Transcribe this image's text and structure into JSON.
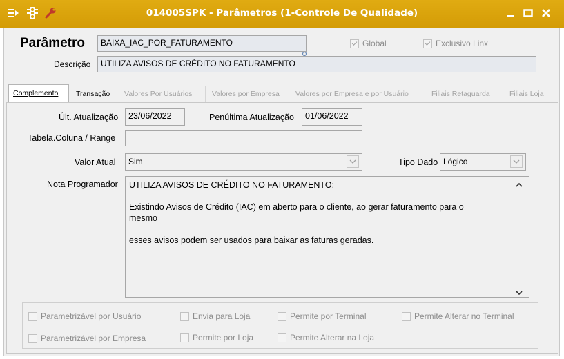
{
  "window": {
    "title": "014005SPK - Parâmetros (1-Controle De Qualidade)"
  },
  "header": {
    "parametro_label": "Parâmetro",
    "parametro_value": "BAIXA_IAC_POR_FATURAMENTO",
    "global_label": "Global",
    "global_checked": true,
    "exclusivo_label": "Exclusivo Linx",
    "exclusivo_checked": true,
    "descricao_label": "Descrição",
    "descricao_value": "UTILIZA AVISOS DE CRÉDITO NO FATURAMENTO"
  },
  "tabs": [
    {
      "label": "Complemento",
      "state": "active"
    },
    {
      "label": "Transação",
      "state": "enabled"
    },
    {
      "label": "Valores Por Usuários",
      "state": "disabled"
    },
    {
      "label": "Valores por Empresa",
      "state": "disabled"
    },
    {
      "label": "Valores por Empresa e por Usuário",
      "state": "disabled"
    },
    {
      "label": "Filiais Retaguarda",
      "state": "disabled"
    },
    {
      "label": "Filiais Loja",
      "state": "disabled"
    }
  ],
  "form": {
    "ult_atualizacao_label": "Últ. Atualização",
    "ult_atualizacao_value": "23/06/2022",
    "penultima_label": "Penúltima Atualização",
    "penultima_value": "01/06/2022",
    "tabela_label": "Tabela.Coluna / Range",
    "tabela_value": "",
    "valor_atual_label": "Valor Atual",
    "valor_atual_value": "Sim",
    "tipo_dado_label": "Tipo Dado",
    "tipo_dado_value": "Lógico",
    "nota_label": "Nota Programador",
    "nota_lines": [
      "UTILIZA AVISOS DE CRÉDITO NO FATURAMENTO:",
      "",
      "Existindo Avisos de Crédito (IAC) em aberto para o cliente, ao gerar faturamento para o",
      "mesmo",
      "",
      "esses avisos podem ser usados para baixar as faturas geradas."
    ]
  },
  "options": {
    "parametrizavel_usuario": "Parametrizável por Usuário",
    "envia_loja": "Envia para Loja",
    "permite_terminal": "Permite por Terminal",
    "permite_alterar_terminal": "Permite Alterar no Terminal",
    "parametrizavel_empresa": "Parametrizável por Empresa",
    "permite_loja": "Permite por Loja",
    "permite_alterar_loja": "Permite Alterar na Loja"
  },
  "colors": {
    "titlebar": "#d9a30c",
    "window_bg": "#f0f0f0"
  },
  "icons": [
    "menu-icon",
    "traffic-light-icon",
    "wrench-icon",
    "minimize-icon",
    "maximize-icon",
    "close-icon"
  ]
}
